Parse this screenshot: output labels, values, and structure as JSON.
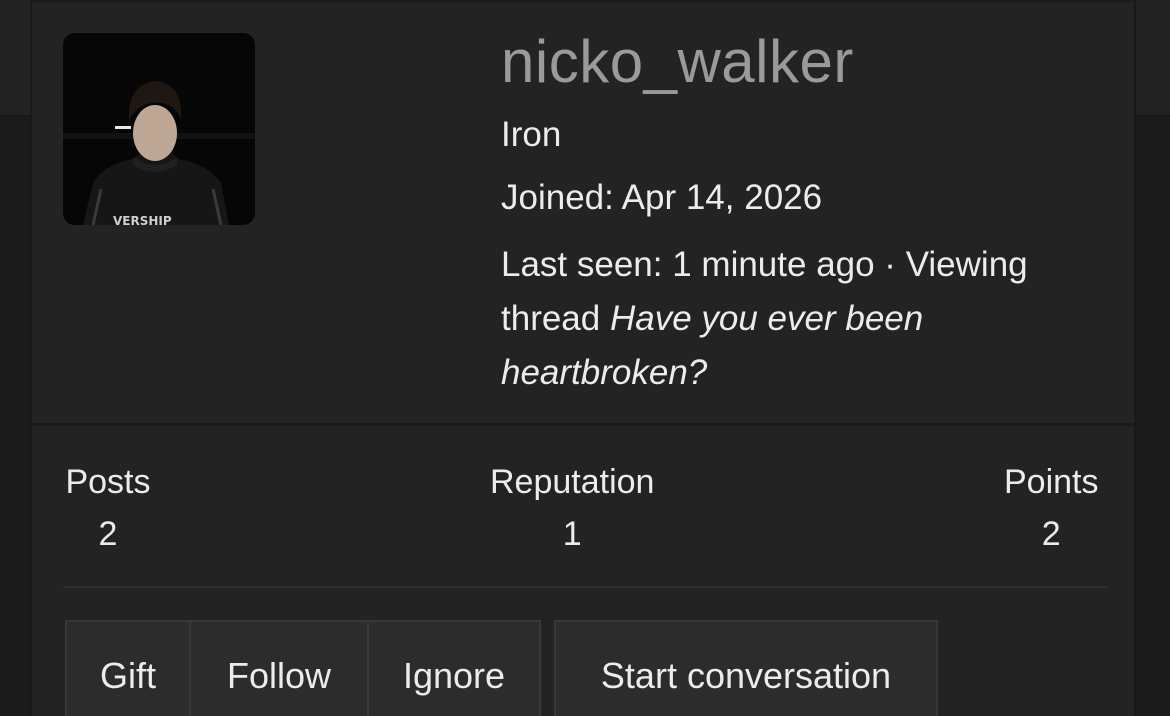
{
  "profile": {
    "username": "nicko_walker",
    "rank": "Iron",
    "joined": "Joined: Apr 14, 2026",
    "last_seen_prefix": "Last seen: 1 minute ago · Viewing thread ",
    "last_seen_thread": "Have you ever been heartbroken?",
    "avatar_shirt_text": "VERSHIP"
  },
  "stats": {
    "posts_label": "Posts",
    "posts_value": "2",
    "reputation_label": "Reputation",
    "reputation_value": "1",
    "points_label": "Points",
    "points_value": "2"
  },
  "actions": {
    "gift": "Gift",
    "follow": "Follow",
    "ignore": "Ignore",
    "start_conversation": "Start conversation"
  },
  "colors": {
    "background": "#1b1b1b",
    "card": "#232323",
    "button": "#2c2c2c",
    "username": "#9a9a9a",
    "text": "#ececec"
  }
}
